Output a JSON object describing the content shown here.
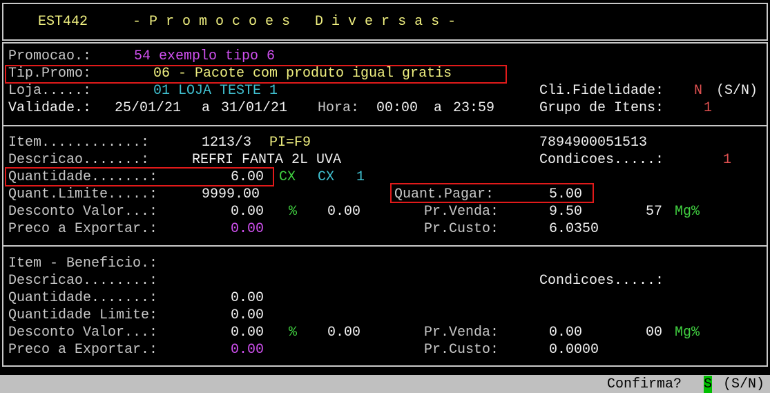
{
  "colors": {
    "background": "#000000",
    "label": "#c8c8c8",
    "yellow": "#f0f080",
    "magenta": "#d050f0",
    "cyan": "#40c0d0",
    "red": "#e05050",
    "green": "#40d040",
    "white": "#f0f0f0",
    "highlight_box": "#e11a1a",
    "status_bar": "#c0c0c0"
  },
  "header": {
    "code": "EST442",
    "title": "- P r o m o c o e s   D i v e r s a s -"
  },
  "promo": {
    "promocao_label": "Promocao.:",
    "promocao_value": "54 exemplo tipo 6",
    "tip_label": "Tip.Promo:",
    "tip_value": "06 - Pacote com produto igual gratis",
    "loja_label": "Loja.....:",
    "loja_value": "01 LOJA TESTE 1",
    "cli_label": "Cli.Fidelidade:",
    "cli_value": "N",
    "cli_options": "(S/N)",
    "validade_label": "Validade.:",
    "validade_from": "25/01/21",
    "validade_sep": "a",
    "validade_to": "31/01/21",
    "hora_label": "Hora:",
    "hora_from": "00:00",
    "hora_sep": "a",
    "hora_to": "23:59",
    "grupo_label": "Grupo de Itens:",
    "grupo_value": "1"
  },
  "item": {
    "item_label": "Item............:",
    "item_code": "1213/3",
    "item_pi": "PI=F9",
    "barcode": "7894900051513",
    "descricao_label": "Descricao.......:",
    "descricao_value": "REFRI FANTA 2L UVA",
    "condicoes_label": "Condicoes.....:",
    "condicoes_value": "1",
    "quantidade_label": "Quantidade.......:",
    "quantidade_value": "6.00",
    "unit1": "CX",
    "unit2": "CX",
    "unit_qty": "1",
    "limite_label": "Quant.Limite.....:",
    "limite_value": "9999.00",
    "pagar_label": "Quant.Pagar:",
    "pagar_value": "5.00",
    "desconto_label": "Desconto Valor...:",
    "desconto_value": "0.00",
    "pct_symbol": "%",
    "pct_value": "0.00",
    "venda_label": "Pr.Venda:",
    "venda_value": "9.50",
    "mg_value": "57",
    "mg_label": "Mg%",
    "exportar_label": "Preco a Exportar.:",
    "exportar_value": "0.00",
    "custo_label": "Pr.Custo:",
    "custo_value": "6.0350"
  },
  "beneficio": {
    "item_label": "Item - Beneficio.:",
    "descricao_label": "Descricao........:",
    "condicoes_label": "Condicoes.....:",
    "quantidade_label": "Quantidade.......:",
    "quantidade_value": "0.00",
    "limite_label": "Quantidade Limite:",
    "limite_value": "0.00",
    "desconto_label": "Desconto Valor...:",
    "desconto_value": "0.00",
    "pct_symbol": "%",
    "pct_value": "0.00",
    "venda_label": "Pr.Venda:",
    "venda_value": "0.00",
    "mg_value": "00",
    "mg_label": "Mg%",
    "exportar_label": "Preco a Exportar.:",
    "exportar_value": "0.00",
    "custo_label": "Pr.Custo:",
    "custo_value": "0.0000"
  },
  "status": {
    "prompt": "Confirma?",
    "answer": "S",
    "options": "(S/N)"
  }
}
